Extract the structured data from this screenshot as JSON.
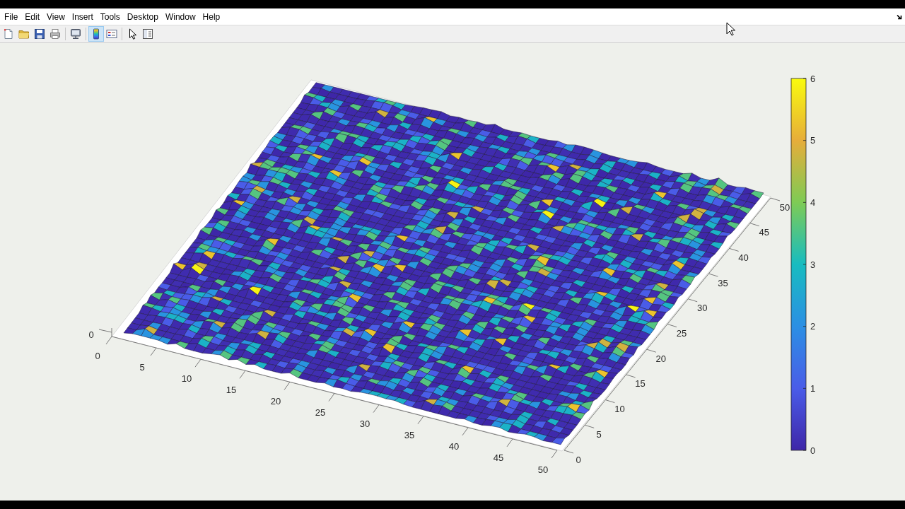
{
  "menu_bar": {
    "items": [
      "File",
      "Edit",
      "View",
      "Insert",
      "Tools",
      "Desktop",
      "Window",
      "Help"
    ]
  },
  "toolbar": {
    "groups": [
      [
        {
          "kind": "new_file",
          "on": false
        },
        {
          "kind": "open",
          "on": false
        },
        {
          "kind": "save",
          "on": false
        },
        {
          "kind": "print",
          "on": false
        }
      ],
      [
        {
          "kind": "print_preview",
          "on": false
        }
      ],
      [
        {
          "kind": "colorbar",
          "on": true
        },
        {
          "kind": "legend",
          "on": false
        }
      ],
      [
        {
          "kind": "pointer",
          "on": false
        },
        {
          "kind": "property_editor",
          "on": false
        }
      ]
    ]
  },
  "figure": {
    "axes": {
      "x_ticks": [
        "0",
        "5",
        "10",
        "15",
        "20",
        "25",
        "30",
        "35",
        "40",
        "45",
        "50"
      ],
      "y_ticks": [
        "0",
        "5",
        "10",
        "15",
        "20",
        "25",
        "30",
        "35",
        "40",
        "45",
        "50"
      ],
      "z_ticks": [
        "0"
      ]
    },
    "colorbar": {
      "ticks": [
        "6",
        "5",
        "4",
        "3",
        "2",
        "1",
        "0"
      ]
    }
  }
}
